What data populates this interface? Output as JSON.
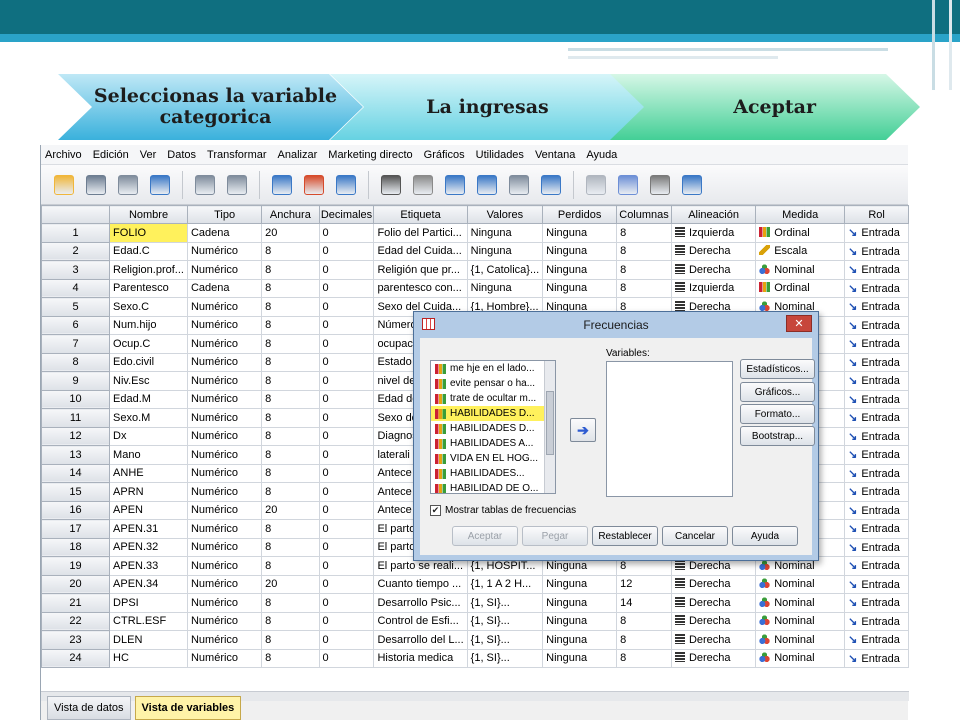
{
  "process": {
    "step1": "Seleccionas la variable categorica",
    "step2": "La ingresas",
    "step3": "Aceptar"
  },
  "menu": [
    "Archivo",
    "Edición",
    "Ver",
    "Datos",
    "Transformar",
    "Analizar",
    "Marketing directo",
    "Gráficos",
    "Utilidades",
    "Ventana",
    "Ayuda"
  ],
  "toolbar_icons": [
    "open-folder-icon",
    "save-icon",
    "print-icon",
    "dialog-recall-icon",
    "undo-icon",
    "redo-icon",
    "goto-case-icon",
    "goto-variable-icon",
    "variables-icon",
    "find-icon",
    "insert-cases-icon",
    "insert-variable-icon",
    "split-file-icon",
    "weight-cases-icon",
    "select-cases-icon",
    "value-labels-icon",
    "use-sets-icon",
    "show-all-icon",
    "spelling-icon"
  ],
  "grid": {
    "headers": [
      "Nombre",
      "Tipo",
      "Anchura",
      "Decimales",
      "Etiqueta",
      "Valores",
      "Perdidos",
      "Columnas",
      "Alineación",
      "Medida",
      "Rol"
    ],
    "rows": [
      [
        "1",
        "FOLIO",
        "Cadena",
        "20",
        "0",
        "Folio del Partici...",
        "Ninguna",
        "Ninguna",
        "8",
        "Izquierda",
        "Ordinal",
        "Entrada"
      ],
      [
        "2",
        "Edad.C",
        "Numérico",
        "8",
        "0",
        "Edad del Cuida...",
        "Ninguna",
        "Ninguna",
        "8",
        "Derecha",
        "Escala",
        "Entrada"
      ],
      [
        "3",
        "Religion.prof...",
        "Numérico",
        "8",
        "0",
        "Religión que pr...",
        "{1, Catolica}...",
        "Ninguna",
        "8",
        "Derecha",
        "Nominal",
        "Entrada"
      ],
      [
        "4",
        "Parentesco",
        "Cadena",
        "8",
        "0",
        "parentesco con...",
        "Ninguna",
        "Ninguna",
        "8",
        "Izquierda",
        "Ordinal",
        "Entrada"
      ],
      [
        "5",
        "Sexo.C",
        "Numérico",
        "8",
        "0",
        "Sexo del Cuida...",
        "{1, Hombre}...",
        "Ninguna",
        "8",
        "Derecha",
        "Nominal",
        "Entrada"
      ],
      [
        "6",
        "Num.hijo",
        "Numérico",
        "8",
        "0",
        "Número",
        "",
        "",
        "",
        "",
        "",
        "Entrada"
      ],
      [
        "7",
        "Ocup.C",
        "Numérico",
        "8",
        "0",
        "ocupaci",
        "",
        "",
        "",
        "",
        "",
        "Entrada"
      ],
      [
        "8",
        "Edo.civil",
        "Numérico",
        "8",
        "0",
        "Estado",
        "",
        "",
        "",
        "",
        "",
        "Entrada"
      ],
      [
        "9",
        "Niv.Esc",
        "Numérico",
        "8",
        "0",
        "nivel de",
        "",
        "",
        "",
        "",
        "",
        "Entrada"
      ],
      [
        "10",
        "Edad.M",
        "Numérico",
        "8",
        "0",
        "Edad de",
        "",
        "",
        "",
        "",
        "",
        "Entrada"
      ],
      [
        "11",
        "Sexo.M",
        "Numérico",
        "8",
        "0",
        "Sexo de",
        "",
        "",
        "",
        "",
        "",
        "Entrada"
      ],
      [
        "12",
        "Dx",
        "Numérico",
        "8",
        "0",
        "Diagnos",
        "",
        "",
        "",
        "",
        "",
        "Entrada"
      ],
      [
        "13",
        "Mano",
        "Numérico",
        "8",
        "0",
        "laterali",
        "",
        "",
        "",
        "",
        "",
        "Entrada"
      ],
      [
        "14",
        "ANHE",
        "Numérico",
        "8",
        "0",
        "Antece",
        "",
        "",
        "",
        "",
        "",
        "Entrada"
      ],
      [
        "15",
        "APRN",
        "Numérico",
        "8",
        "0",
        "Antece",
        "",
        "",
        "",
        "",
        "",
        "Entrada"
      ],
      [
        "16",
        "APEN",
        "Numérico",
        "20",
        "0",
        "Antece",
        "",
        "",
        "",
        "",
        "",
        "Entrada"
      ],
      [
        "17",
        "APEN.31",
        "Numérico",
        "8",
        "0",
        "El parto",
        "",
        "",
        "",
        "",
        "",
        "Entrada"
      ],
      [
        "18",
        "APEN.32",
        "Numérico",
        "8",
        "0",
        "El parto",
        "",
        "",
        "",
        "",
        "",
        "Entrada"
      ],
      [
        "19",
        "APEN.33",
        "Numérico",
        "8",
        "0",
        "El parto se reali...",
        "{1, HOSPIT...",
        "Ninguna",
        "8",
        "Derecha",
        "Nominal",
        "Entrada"
      ],
      [
        "20",
        "APEN.34",
        "Numérico",
        "20",
        "0",
        "Cuanto tiempo ...",
        "{1, 1 A 2 H...",
        "Ninguna",
        "12",
        "Derecha",
        "Nominal",
        "Entrada"
      ],
      [
        "21",
        "DPSI",
        "Numérico",
        "8",
        "0",
        "Desarrollo Psic...",
        "{1, SI}...",
        "Ninguna",
        "14",
        "Derecha",
        "Nominal",
        "Entrada"
      ],
      [
        "22",
        "CTRL.ESF",
        "Numérico",
        "8",
        "0",
        "Control de Esfi...",
        "{1, SI}...",
        "Ninguna",
        "8",
        "Derecha",
        "Nominal",
        "Entrada"
      ],
      [
        "23",
        "DLEN",
        "Numérico",
        "8",
        "0",
        "Desarrollo del L...",
        "{1, SI}...",
        "Ninguna",
        "8",
        "Derecha",
        "Nominal",
        "Entrada"
      ],
      [
        "24",
        "HC",
        "Numérico",
        "8",
        "0",
        "Historia medica",
        "{1, SI}...",
        "Ninguna",
        "8",
        "Derecha",
        "Nominal",
        "Entrada"
      ]
    ]
  },
  "tabs": {
    "data_view": "Vista de datos",
    "variable_view": "Vista de variables"
  },
  "dialog": {
    "title": "Frecuencias",
    "close": "✕",
    "source_items": [
      "me hje en el lado...",
      "evite pensar o ha...",
      "trate de ocultar m...",
      "HABILIDADES D...",
      "HABILIDADES D...",
      "HABILIDADES A...",
      "VIDA EN EL HOG...",
      "HABILIDADES...",
      "HABILIDAD DE O..."
    ],
    "variables_label": "Variables:",
    "side_buttons": [
      "Estadísticos...",
      "Gráficos...",
      "Formato...",
      "Bootstrap..."
    ],
    "checkbox_label": "Mostrar tablas de frecuencias",
    "bottom_buttons": [
      "Aceptar",
      "Pegar",
      "Restablecer",
      "Cancelar",
      "Ayuda"
    ]
  },
  "colors": {
    "header_dark": "#0f6f80",
    "header_light": "#2aa3c8",
    "selected_cell": "#fff15c",
    "dialog_frame": "#b3cbe6"
  }
}
